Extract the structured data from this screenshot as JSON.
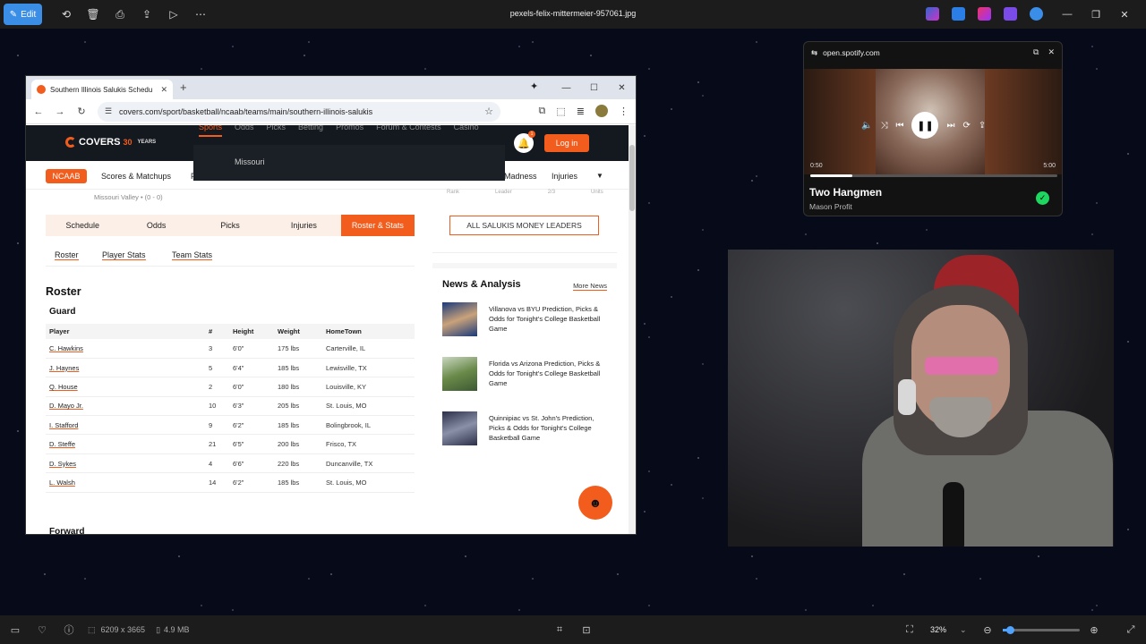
{
  "viewer": {
    "edit_label": "Edit",
    "file_title": "pexels-felix-mittermeier-957061.jpg",
    "dimensions": "6209 x 3665",
    "size": "4.9 MB",
    "zoom": "32%",
    "zoom_fraction": 0.32
  },
  "browser": {
    "tab_title": "Southern Illinois Salukis Schedu",
    "url": "covers.com/sport/basketball/ncaab/teams/main/southern-illinois-salukis"
  },
  "site": {
    "logo_text": "COVERS",
    "logo_thirty": "30",
    "logo_years": "YEARS",
    "menu": [
      "Sports",
      "Odds",
      "Picks",
      "Betting",
      "Promos",
      "Forum & Contests",
      "Casino"
    ],
    "dropdown_item": "Missouri",
    "login_label": "Log in",
    "notification_count": "1",
    "subnav": {
      "ncaab": "NCAAB",
      "scores": "Scores & Matchups",
      "partial_f": "F",
      "madness": "Madness",
      "injuries": "Injuries"
    },
    "conference": "Missouri Valley • (0 - 0)",
    "team_tabs": [
      "Schedule",
      "Odds",
      "Picks",
      "Injuries",
      "Roster & Stats"
    ],
    "sub_tabs": [
      "Roster",
      "Player Stats",
      "Team Stats"
    ],
    "roster_title": "Roster",
    "guard_title": "Guard",
    "forward_title": "Forward",
    "columns": [
      "Player",
      "#",
      "Height",
      "Weight",
      "HomeTown"
    ],
    "guards": [
      [
        "C. Hawkins",
        "3",
        "6'0\"",
        "175 lbs",
        "Carterville, IL"
      ],
      [
        "J. Haynes",
        "5",
        "6'4\"",
        "185 lbs",
        "Lewisville, TX"
      ],
      [
        "Q. House",
        "2",
        "6'0\"",
        "180 lbs",
        "Louisville, KY"
      ],
      [
        "D. Mayo Jr.",
        "10",
        "6'3\"",
        "205 lbs",
        "St. Louis, MO"
      ],
      [
        "I. Stafford",
        "9",
        "6'2\"",
        "185 lbs",
        "Bolingbrook, IL"
      ],
      [
        "D. Steffe",
        "21",
        "6'5\"",
        "200 lbs",
        "Frisco, TX"
      ],
      [
        "D. Sykes",
        "4",
        "6'6\"",
        "220 lbs",
        "Duncanville, TX"
      ],
      [
        "L. Walsh",
        "14",
        "6'2\"",
        "185 lbs",
        "St. Louis, MO"
      ]
    ],
    "stats_head": [
      "Rank",
      "Leader",
      "2/3",
      "Units"
    ],
    "money_leaders": "ALL SALUKIS MONEY LEADERS",
    "news_title": "News & Analysis",
    "more_news": "More News",
    "news": [
      "Villanova vs BYU Prediction, Picks & Odds for Tonight's College Basketball Game",
      "Florida vs Arizona Prediction, Picks & Odds for Tonight's College Basketball Game",
      "Quinnipiac vs St. John's Prediction, Picks & Odds for Tonight's College Basketball Game"
    ]
  },
  "spotify": {
    "domain": "open.spotify.com",
    "elapsed": "0:50",
    "duration": "5:00",
    "progress_fraction": 0.17,
    "song": "Two Hangmen",
    "artist": "Mason Profit"
  },
  "colors": {
    "accent": "#f25c1c",
    "header": "#14181f",
    "spotify_green": "#1ed760"
  }
}
